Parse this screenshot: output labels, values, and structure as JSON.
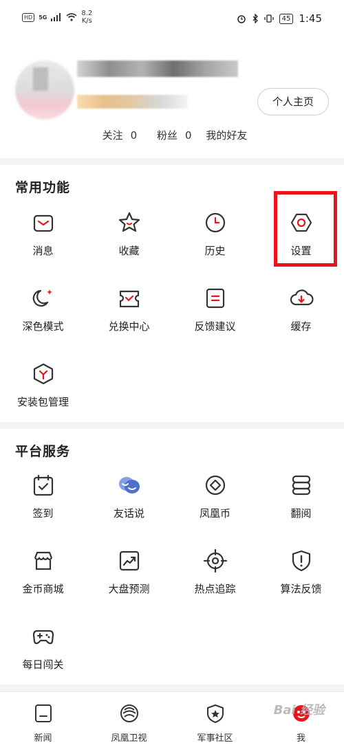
{
  "status_bar": {
    "hd": "HD",
    "signal": "5G",
    "speed_value": "8.2",
    "speed_unit": "K/s",
    "battery": "45",
    "time": "1:45"
  },
  "profile": {
    "homepage_button": "个人主页",
    "follow": "关注",
    "follow_count": "0",
    "fans": "粉丝",
    "fans_count": "0",
    "friends": "我的好友"
  },
  "common": {
    "title": "常用功能",
    "items": [
      {
        "label": "消息",
        "icon": "message-icon"
      },
      {
        "label": "收藏",
        "icon": "star-icon"
      },
      {
        "label": "历史",
        "icon": "clock-icon"
      },
      {
        "label": "设置",
        "icon": "settings-icon"
      },
      {
        "label": "深色模式",
        "icon": "moon-icon"
      },
      {
        "label": "兑换中心",
        "icon": "ticket-icon"
      },
      {
        "label": "反馈建议",
        "icon": "feedback-icon"
      },
      {
        "label": "缓存",
        "icon": "cloud-download-icon"
      },
      {
        "label": "安装包管理",
        "icon": "package-icon"
      }
    ]
  },
  "platform": {
    "title": "平台服务",
    "items": [
      {
        "label": "签到",
        "icon": "checkin-icon"
      },
      {
        "label": "友话说",
        "icon": "chat-bubbles-icon"
      },
      {
        "label": "凤凰币",
        "icon": "coin-icon"
      },
      {
        "label": "翻阅",
        "icon": "book-icon"
      },
      {
        "label": "金币商城",
        "icon": "store-icon"
      },
      {
        "label": "大盘预测",
        "icon": "trend-icon"
      },
      {
        "label": "热点追踪",
        "icon": "target-icon"
      },
      {
        "label": "算法反馈",
        "icon": "shield-alert-icon"
      },
      {
        "label": "每日闯关",
        "icon": "gamepad-icon"
      }
    ]
  },
  "bottom_nav": [
    {
      "label": "新闻",
      "icon": "news-icon"
    },
    {
      "label": "凤凰卫视",
      "icon": "phoenix-icon"
    },
    {
      "label": "军事社区",
      "icon": "military-icon"
    },
    {
      "label": "我",
      "icon": "me-icon"
    }
  ],
  "watermark": "Bai 经验",
  "colors": {
    "accent": "#e8141d",
    "icon": "#333333",
    "highlight": "#e8141d",
    "blue": "#5b7fd6"
  }
}
